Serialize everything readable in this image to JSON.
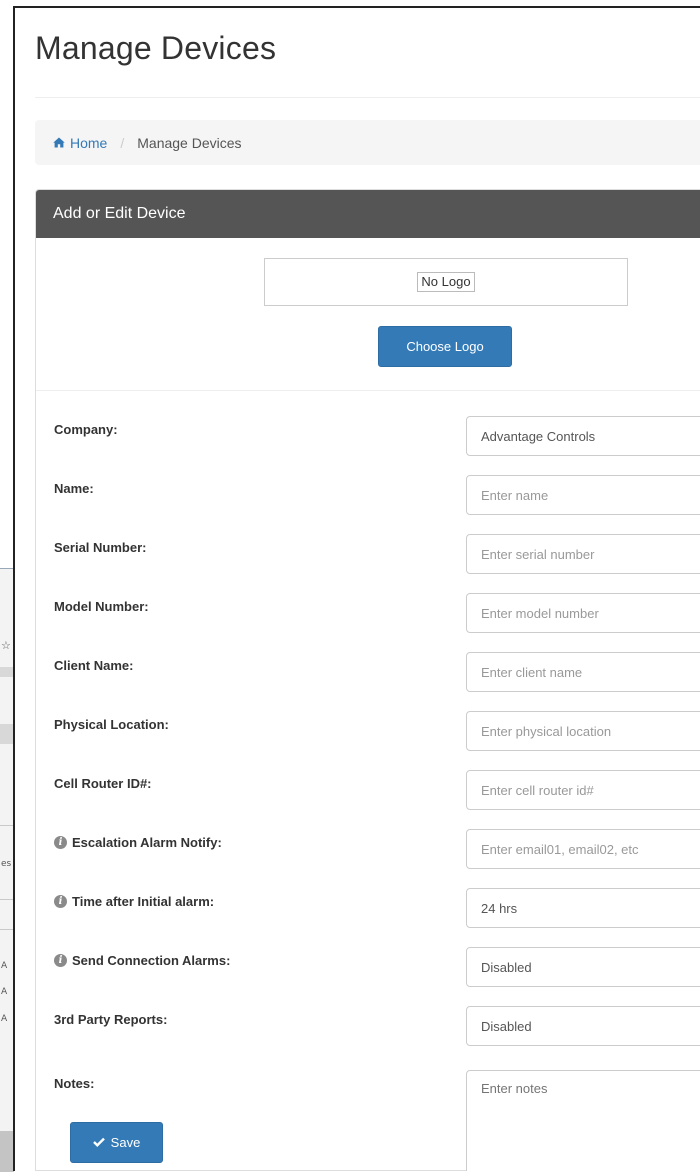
{
  "page": {
    "title": "Manage Devices"
  },
  "breadcrumb": {
    "home_label": "Home",
    "current_label": "Manage Devices",
    "separator": "/"
  },
  "panel": {
    "heading": "Add or Edit Device",
    "logo_placeholder": "No Logo",
    "choose_logo_label": "Choose Logo"
  },
  "form": {
    "fields": [
      {
        "label": "Company:",
        "value": "Advantage Controls",
        "placeholder": "",
        "info": false,
        "kind": "select"
      },
      {
        "label": "Name:",
        "value": "",
        "placeholder": "Enter name",
        "info": false,
        "kind": "text"
      },
      {
        "label": "Serial Number:",
        "value": "",
        "placeholder": "Enter serial number",
        "info": false,
        "kind": "text"
      },
      {
        "label": "Model Number:",
        "value": "",
        "placeholder": "Enter model number",
        "info": false,
        "kind": "text"
      },
      {
        "label": "Client Name:",
        "value": "",
        "placeholder": "Enter client name",
        "info": false,
        "kind": "text"
      },
      {
        "label": "Physical Location:",
        "value": "",
        "placeholder": "Enter physical location",
        "info": false,
        "kind": "text"
      },
      {
        "label": "Cell Router ID#:",
        "value": "",
        "placeholder": "Enter cell router id#",
        "info": false,
        "kind": "text"
      },
      {
        "label": "Escalation Alarm Notify:",
        "value": "",
        "placeholder": "Enter email01, email02, etc",
        "info": true,
        "kind": "text"
      },
      {
        "label": "Time after Initial alarm:",
        "value": "24 hrs",
        "placeholder": "",
        "info": true,
        "kind": "select"
      },
      {
        "label": "Send Connection Alarms:",
        "value": "Disabled",
        "placeholder": "",
        "info": true,
        "kind": "select"
      },
      {
        "label": "3rd Party Reports:",
        "value": "Disabled",
        "placeholder": "",
        "info": false,
        "kind": "select"
      }
    ],
    "notes": {
      "label": "Notes:",
      "placeholder": "Enter notes"
    },
    "save_label": "Save"
  },
  "icons": {
    "home": "home-icon",
    "info": "info-icon",
    "save": "checkmark-icon"
  },
  "colors": {
    "primary": "#337ab7",
    "link": "#337ab7",
    "panel_heading": "#555555",
    "breadcrumb_bg": "#f5f5f5"
  },
  "background_window": {
    "glyphs": [
      "☆",
      "es",
      "A",
      "A",
      "A"
    ]
  }
}
